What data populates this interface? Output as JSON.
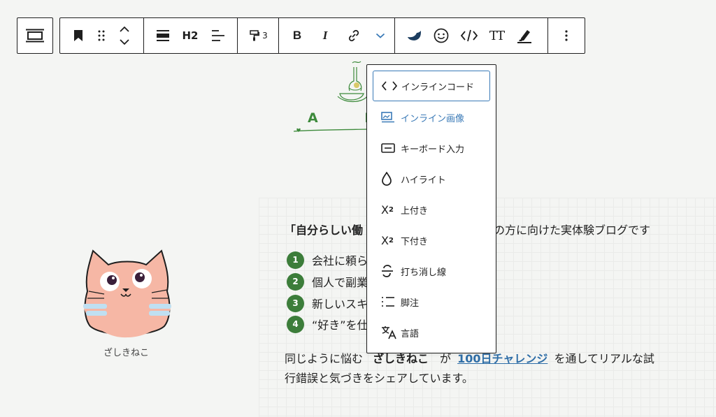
{
  "toolbar": {
    "heading_level": "H2",
    "text_color_number": "3",
    "bold_label": "B",
    "italic_label": "I",
    "font_size_label": "TT"
  },
  "format_menu": {
    "items": [
      {
        "label": "インラインコード",
        "icon": "code-icon"
      },
      {
        "label": "インライン画像",
        "icon": "image-icon"
      },
      {
        "label": "キーボード入力",
        "icon": "keyboard-icon"
      },
      {
        "label": "ハイライト",
        "icon": "highlight-icon"
      },
      {
        "label": "上付き",
        "icon": "superscript-icon"
      },
      {
        "label": "下付き",
        "icon": "subscript-icon"
      },
      {
        "label": "打ち消し線",
        "icon": "strikethrough-icon"
      },
      {
        "label": "脚注",
        "icon": "footnote-icon"
      },
      {
        "label": "言語",
        "icon": "language-icon"
      }
    ]
  },
  "header": {
    "about_visible": "A B O"
  },
  "profile": {
    "name": "ざしきねこ"
  },
  "content": {
    "lead_bold": "「自分らしい働",
    "lead_rest": "の方に向けた実体験ブログです",
    "list": [
      {
        "num": "1",
        "text": "会社に頼ら"
      },
      {
        "num": "2",
        "text": "個人で副業"
      },
      {
        "num": "3",
        "text": "新しいスキ"
      },
      {
        "num": "4",
        "text": "“好き”を仕"
      }
    ],
    "para_line1_a": "同じように悩む",
    "para_line1_bold": "ざしきねこ",
    "para_line1_b": "が",
    "para_link": "100日チャレンジ",
    "para_line1_c": "を通してリアルな試",
    "para_line2": "行錯誤と気づきをシェアしています。"
  },
  "colors": {
    "accent_green": "#3c7d3a",
    "link_blue": "#2f6ea7",
    "menu_focus": "#3a7ab7"
  }
}
